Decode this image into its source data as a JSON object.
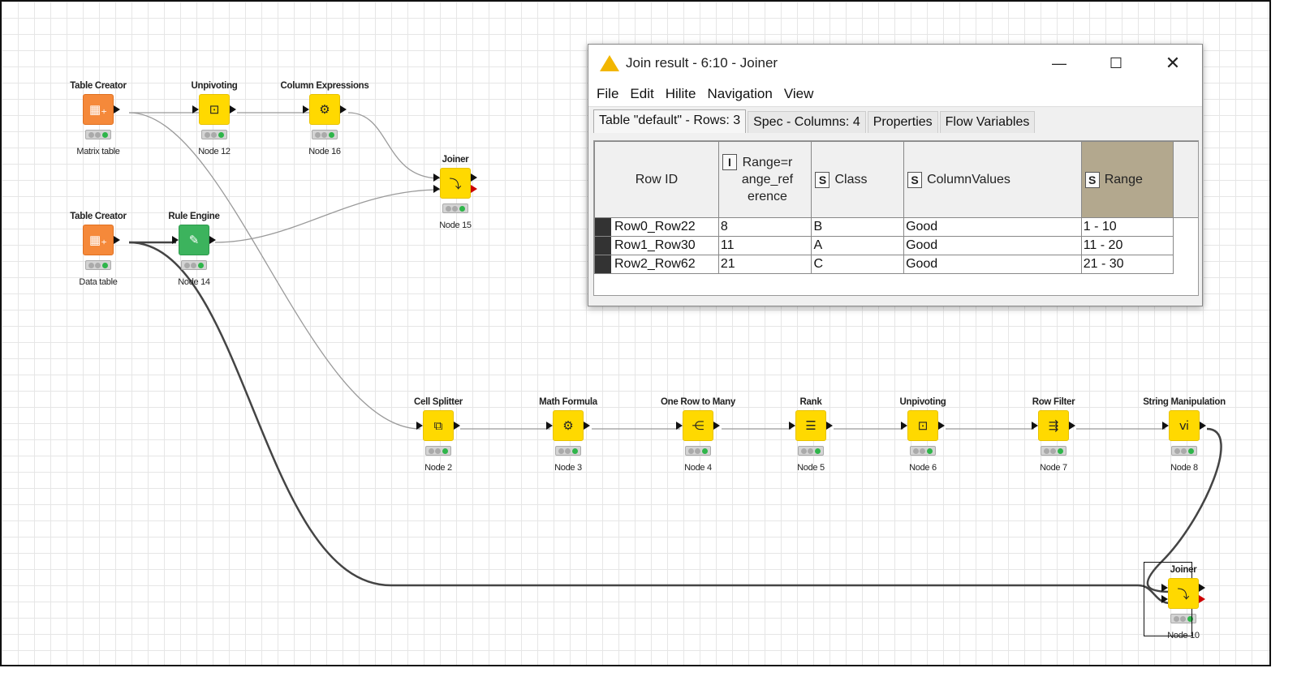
{
  "workflow": {
    "nodes": [
      {
        "id": "tc1",
        "title": "Table Creator",
        "label": "Matrix table",
        "color": "orange",
        "icon": "table-plus-icon",
        "glyph": "▦₊"
      },
      {
        "id": "unp12",
        "title": "Unpivoting",
        "label": "Node 12",
        "color": "yellow",
        "icon": "unpivot-icon",
        "glyph": "⊡"
      },
      {
        "id": "ce16",
        "title": "Column Expressions",
        "label": "Node 16",
        "color": "yellow",
        "icon": "expression-icon",
        "glyph": "⚙"
      },
      {
        "id": "join15",
        "title": "Joiner",
        "label": "Node 15",
        "color": "yellow",
        "icon": "joiner-icon",
        "glyph": "⤵"
      },
      {
        "id": "tc2",
        "title": "Table Creator",
        "label": "Data table",
        "color": "orange",
        "icon": "table-plus-icon",
        "glyph": "▦₊"
      },
      {
        "id": "re14",
        "title": "Rule Engine",
        "label": "Node 14",
        "color": "green",
        "icon": "rule-icon",
        "glyph": "✎"
      },
      {
        "id": "cs2",
        "title": "Cell Splitter",
        "label": "Node 2",
        "color": "yellow",
        "icon": "cell-splitter-icon",
        "glyph": "⧉"
      },
      {
        "id": "mf3",
        "title": "Math Formula",
        "label": "Node 3",
        "color": "yellow",
        "icon": "math-formula-icon",
        "glyph": "⚙"
      },
      {
        "id": "orm4",
        "title": "One Row to Many",
        "label": "Node 4",
        "color": "yellow",
        "icon": "row-to-many-icon",
        "glyph": "⋲"
      },
      {
        "id": "rank5",
        "title": "Rank",
        "label": "Node 5",
        "color": "yellow",
        "icon": "rank-icon",
        "glyph": "☰"
      },
      {
        "id": "unp6",
        "title": "Unpivoting",
        "label": "Node 6",
        "color": "yellow",
        "icon": "unpivot-icon",
        "glyph": "⊡"
      },
      {
        "id": "rf7",
        "title": "Row Filter",
        "label": "Node 7",
        "color": "yellow",
        "icon": "row-filter-icon",
        "glyph": "⇶"
      },
      {
        "id": "sm8",
        "title": "String Manipulation",
        "label": "Node 8",
        "color": "yellow",
        "icon": "string-manipulation-icon",
        "glyph": "ⅵ"
      },
      {
        "id": "join10",
        "title": "Joiner",
        "label": "Node 10",
        "color": "yellow",
        "icon": "joiner-icon",
        "glyph": "⤵",
        "selected": true
      }
    ]
  },
  "window": {
    "title": "Join result - 6:10 - Joiner",
    "menu": [
      "File",
      "Edit",
      "Hilite",
      "Navigation",
      "View"
    ],
    "tabs": [
      "Table \"default\" - Rows: 3",
      "Spec - Columns: 4",
      "Properties",
      "Flow Variables"
    ],
    "table": {
      "row_id_header": "Row ID",
      "columns": [
        {
          "type": "I",
          "name": "Range=range_reference",
          "lines": [
            "Range=r",
            "ange_ref",
            "erence"
          ]
        },
        {
          "type": "S",
          "name": "Class"
        },
        {
          "type": "S",
          "name": "ColumnValues"
        },
        {
          "type": "S",
          "name": "Range"
        }
      ],
      "rows": [
        [
          "Row0_Row22",
          "8",
          "B",
          "Good",
          "1 - 10"
        ],
        [
          "Row1_Row30",
          "11",
          "A",
          "Good",
          "11 - 20"
        ],
        [
          "Row2_Row62",
          "21",
          "C",
          "Good",
          "21 - 30"
        ]
      ]
    }
  }
}
